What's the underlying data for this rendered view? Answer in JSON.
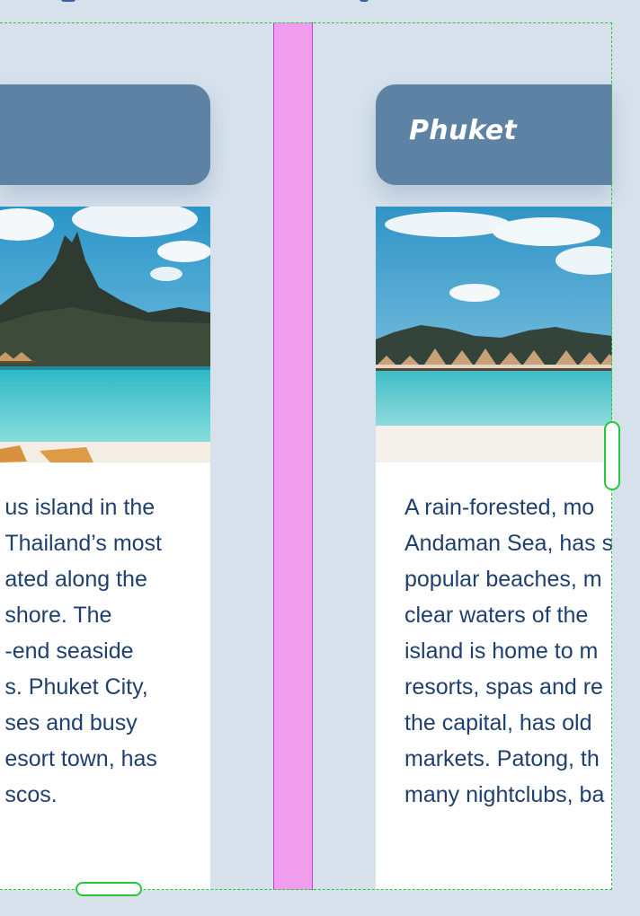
{
  "cards": [
    {
      "id": "left",
      "title": "",
      "lines": [
        "us island in the",
        "Thailand’s most",
        "ated along the",
        " shore. The",
        "-end seaside",
        "s. Phuket City,",
        "ses and busy",
        "esort town, has",
        "scos."
      ]
    },
    {
      "id": "right",
      "title": "Phuket",
      "lines": [
        "A rain-forested, mo",
        "Andaman Sea, has s",
        "popular beaches, m",
        "clear waters of the",
        "island is home to m",
        "resorts, spas and re",
        "the capital, has old",
        "markets. Patong, th",
        "many nightclubs, ba"
      ]
    }
  ],
  "colors": {
    "page_background": "#d6e1ec",
    "card_header": "#5d82a4",
    "body_text": "#1f3f6e",
    "selection_outline": "#22c93a",
    "gap_guide": "#f19ded"
  }
}
